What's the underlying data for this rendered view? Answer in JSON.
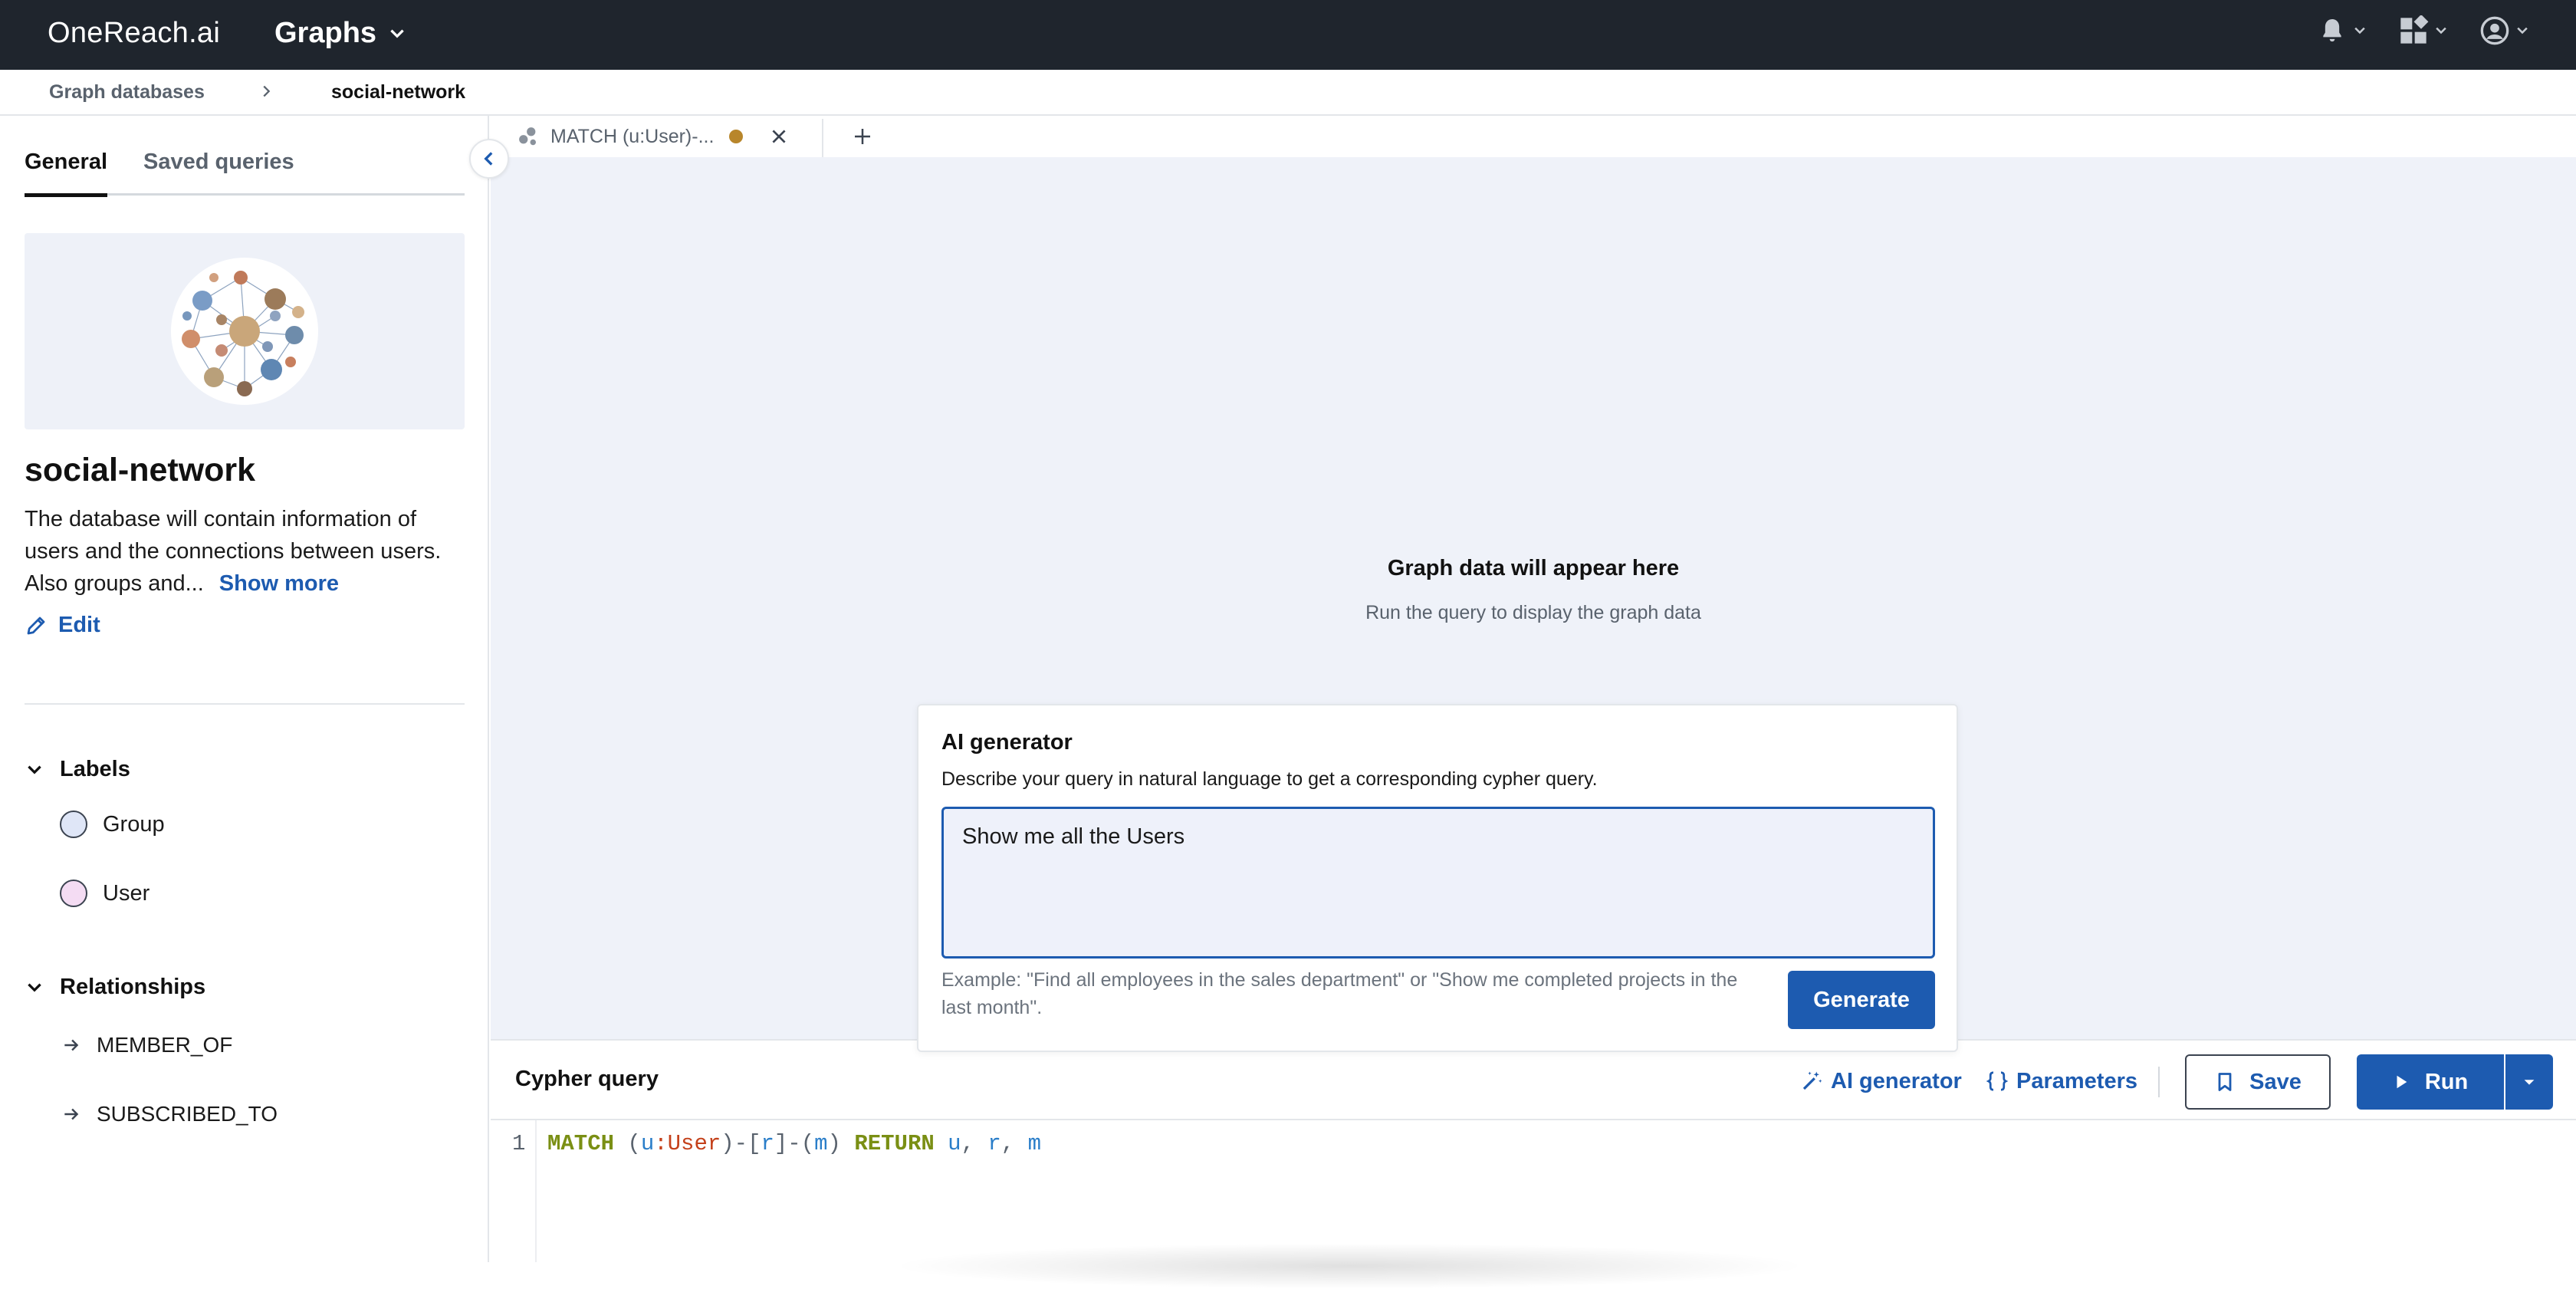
{
  "topbar": {
    "logo": "OneReach.ai",
    "app_name": "Graphs"
  },
  "breadcrumb": {
    "root": "Graph databases",
    "current": "social-network"
  },
  "sidebar": {
    "tabs": [
      "General",
      "Saved queries"
    ],
    "db_name": "social-network",
    "description": "The database will contain information of users and the connections between users. Also groups and...",
    "show_more": "Show more",
    "edit": "Edit",
    "labels_title": "Labels",
    "labels": [
      {
        "name": "Group",
        "color": "#dfe6f7"
      },
      {
        "name": "User",
        "color": "#f4dcf3"
      }
    ],
    "relationships_title": "Relationships",
    "relationships": [
      "MEMBER_OF",
      "SUBSCRIBED_TO"
    ]
  },
  "query_tab": {
    "label": "MATCH (u:User)-...",
    "unsaved_color": "#b8862b"
  },
  "canvas": {
    "empty_title": "Graph data will appear here",
    "empty_sub": "Run the query to display the graph data"
  },
  "ai_generator": {
    "title": "AI generator",
    "description": "Describe your query in natural language to get a corresponding cypher query.",
    "input_value": "Show me all the Users",
    "example": "Example: \"Find all employees in the sales department\" or \"Show me completed projects in the last month\".",
    "generate_label": "Generate"
  },
  "query_bar": {
    "title": "Cypher query",
    "ai_link": "AI generator",
    "params_link": "Parameters",
    "save_label": "Save",
    "run_label": "Run"
  },
  "editor": {
    "line_number": "1",
    "tokens": {
      "match": "MATCH",
      "open1": " (",
      "u1": "u",
      "colon": ":",
      "user": "User",
      "close1": ")-[",
      "r1": "r",
      "close2": "]-(",
      "m1": "m",
      "close3": ") ",
      "ret": "RETURN",
      "sp": " ",
      "u2": "u",
      "c1": ", ",
      "r2": "r",
      "c2": ", ",
      "m2": "m"
    }
  },
  "colors": {
    "accent": "#1d5bb0",
    "topbar": "#1f252d",
    "canvas": "#eff2f9"
  }
}
